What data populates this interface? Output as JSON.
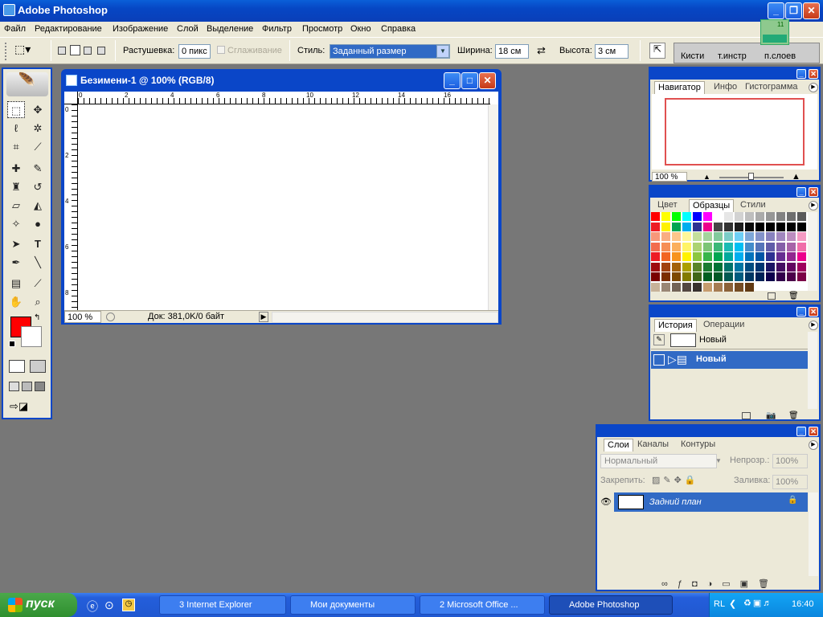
{
  "window": {
    "title": "Adobe Photoshop",
    "min_label": "_",
    "restore_label": "❐",
    "close_label": "✕"
  },
  "menu": [
    "Файл",
    "Редактирование",
    "Изображение",
    "Слой",
    "Выделение",
    "Фильтр",
    "Просмотр",
    "Окно",
    "Справка"
  ],
  "options": {
    "feather_label": "Растушевка:",
    "feather_value": "0 пикс",
    "antialias_label": "Сглаживание",
    "style_label": "Стиль:",
    "style_value": "Заданный размер",
    "width_label": "Ширина:",
    "width_value": "18 см",
    "height_label": "Высота:",
    "height_value": "3 см",
    "well_tabs": [
      "Кисти",
      "т.инстр",
      "п.слоев"
    ],
    "widget_value": "11"
  },
  "document": {
    "title": "Безимени-1 @ 100% (RGB/8)",
    "zoom": "100 %",
    "doc_info": "Док: 381,0K/0 байт",
    "ruler_h": [
      "0",
      "2",
      "4",
      "6",
      "8",
      "10",
      "12",
      "14",
      "16"
    ],
    "ruler_v": [
      "0",
      "2",
      "4",
      "6",
      "8"
    ]
  },
  "navigator": {
    "tabs": [
      "Навигатор",
      "Инфо",
      "Гистограмма"
    ],
    "zoom": "100 %"
  },
  "swatches": {
    "tabs": [
      "Цвет",
      "Образцы",
      "Стили"
    ]
  },
  "history": {
    "tabs": [
      "История",
      "Операции"
    ],
    "snapshot": "Новый",
    "state": "Новый"
  },
  "layers": {
    "tabs": [
      "Слои",
      "Каналы",
      "Контуры"
    ],
    "blend": "Нормальный",
    "opacity_label": "Непрозр.:",
    "opacity": "100%",
    "lock_label": "Закрепить:",
    "fill_label": "Заливка:",
    "fill": "100%",
    "layer_name": "Задний план"
  },
  "taskbar": {
    "start": "пуск",
    "tasks": [
      "3 Internet Explorer",
      "Мои документы",
      "2 Microsoft Office ...",
      "Adobe Photoshop"
    ],
    "lang": "RL",
    "time": "16:40"
  },
  "colors": {
    "foreground": "#ff0000",
    "background": "#ffffff",
    "accent": "#0a46c8"
  },
  "swatch_colors": [
    "#ff0000",
    "#ffff00",
    "#00ff00",
    "#00ffff",
    "#0000ff",
    "#ff00ff",
    "#ffffff",
    "#e6e6e6",
    "#d2d2d2",
    "#bebebe",
    "#aaaaaa",
    "#969696",
    "#828282",
    "#6e6e6e",
    "#5a5a5a",
    "#ed1c24",
    "#fff200",
    "#00a651",
    "#00aeef",
    "#2e3192",
    "#ec008c",
    "#464646",
    "#323232",
    "#1e1e1e",
    "#0a0a0a",
    "#000000",
    "#000000",
    "#000000",
    "#000000",
    "#000000",
    "#f7977a",
    "#f9ad81",
    "#fdc68a",
    "#fff79a",
    "#c4df9b",
    "#a3d39c",
    "#82ca9d",
    "#7bcdc8",
    "#6ecff6",
    "#7ea7d8",
    "#8493ca",
    "#8882be",
    "#a187be",
    "#bc8dbf",
    "#f49ac2",
    "#f26c4f",
    "#f68e55",
    "#fbaf5c",
    "#fff467",
    "#acd372",
    "#7cc576",
    "#3bb878",
    "#1abbb4",
    "#00bff3",
    "#438cca",
    "#5574b9",
    "#605ca8",
    "#855fa8",
    "#a763a8",
    "#f06ea9",
    "#ed1c24",
    "#f26522",
    "#f7941d",
    "#fff200",
    "#8dc73f",
    "#39b54a",
    "#00a651",
    "#00a99d",
    "#00aeef",
    "#0072bc",
    "#0054a6",
    "#2e3192",
    "#662d91",
    "#92278f",
    "#ec008c",
    "#9e0b0f",
    "#a0410d",
    "#a36209",
    "#aba000",
    "#598527",
    "#1a7b30",
    "#007236",
    "#00746b",
    "#0076a3",
    "#004b80",
    "#003471",
    "#1b1464",
    "#440e62",
    "#630460",
    "#9e005d",
    "#790000",
    "#7b2e00",
    "#7d4900",
    "#827b00",
    "#406618",
    "#005e20",
    "#005826",
    "#005952",
    "#005b7f",
    "#003663",
    "#002157",
    "#0d004c",
    "#32004b",
    "#4b0049",
    "#7b0046",
    "#c7b299",
    "#998675",
    "#736357",
    "#534741",
    "#37302d",
    "#c69c6d",
    "#a67c52",
    "#8c6239",
    "#754c24",
    "#603913"
  ]
}
